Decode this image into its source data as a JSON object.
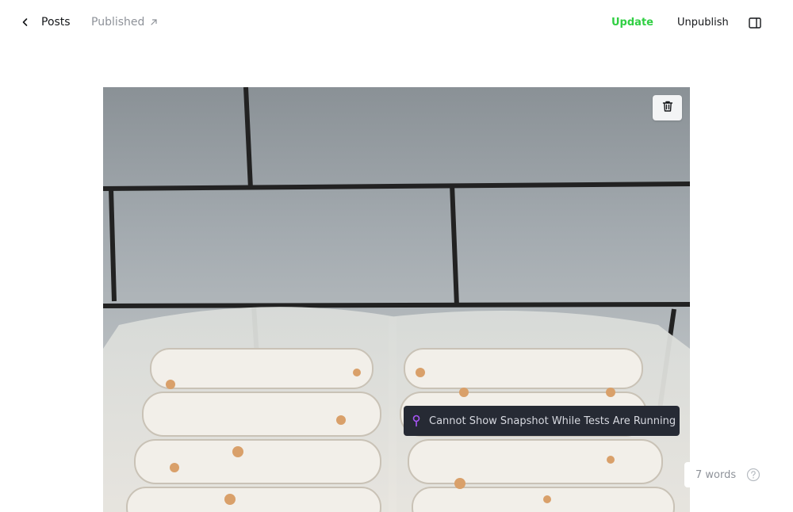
{
  "header": {
    "back_label": "Posts",
    "status_label": "Published",
    "update_label": "Update",
    "unpublish_label": "Unpublish"
  },
  "toast": {
    "message": "Cannot Show Snapshot While Tests Are Running"
  },
  "editor": {
    "word_count": "7 words"
  },
  "colors": {
    "accent_green": "#30cf43",
    "toast_bg": "#262a34",
    "pin_purple": "#a855f7"
  },
  "icons": {
    "back": "chevron-left-icon",
    "status_link": "arrow-up-right-icon",
    "sidebar": "sidebar-toggle-icon",
    "delete": "trash-icon",
    "toast": "pin-icon",
    "help": "question-icon"
  }
}
